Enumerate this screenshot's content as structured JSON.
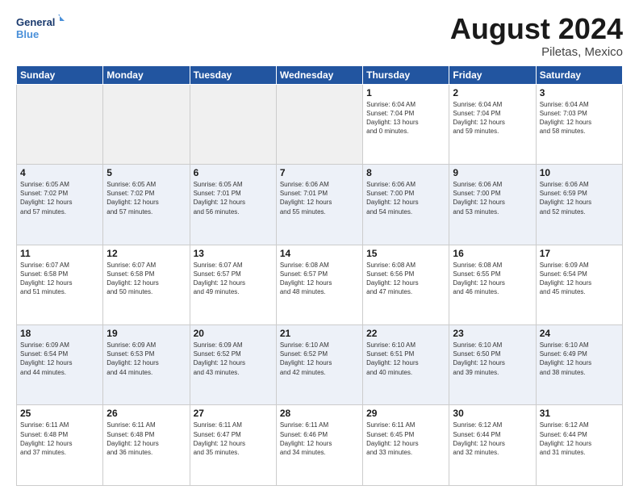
{
  "logo": {
    "line1": "General",
    "line2": "Blue"
  },
  "title": "August 2024",
  "location": "Piletas, Mexico",
  "days_of_week": [
    "Sunday",
    "Monday",
    "Tuesday",
    "Wednesday",
    "Thursday",
    "Friday",
    "Saturday"
  ],
  "weeks": [
    [
      {
        "day": "",
        "info": ""
      },
      {
        "day": "",
        "info": ""
      },
      {
        "day": "",
        "info": ""
      },
      {
        "day": "",
        "info": ""
      },
      {
        "day": "1",
        "info": "Sunrise: 6:04 AM\nSunset: 7:04 PM\nDaylight: 13 hours\nand 0 minutes."
      },
      {
        "day": "2",
        "info": "Sunrise: 6:04 AM\nSunset: 7:04 PM\nDaylight: 12 hours\nand 59 minutes."
      },
      {
        "day": "3",
        "info": "Sunrise: 6:04 AM\nSunset: 7:03 PM\nDaylight: 12 hours\nand 58 minutes."
      }
    ],
    [
      {
        "day": "4",
        "info": "Sunrise: 6:05 AM\nSunset: 7:02 PM\nDaylight: 12 hours\nand 57 minutes."
      },
      {
        "day": "5",
        "info": "Sunrise: 6:05 AM\nSunset: 7:02 PM\nDaylight: 12 hours\nand 57 minutes."
      },
      {
        "day": "6",
        "info": "Sunrise: 6:05 AM\nSunset: 7:01 PM\nDaylight: 12 hours\nand 56 minutes."
      },
      {
        "day": "7",
        "info": "Sunrise: 6:06 AM\nSunset: 7:01 PM\nDaylight: 12 hours\nand 55 minutes."
      },
      {
        "day": "8",
        "info": "Sunrise: 6:06 AM\nSunset: 7:00 PM\nDaylight: 12 hours\nand 54 minutes."
      },
      {
        "day": "9",
        "info": "Sunrise: 6:06 AM\nSunset: 7:00 PM\nDaylight: 12 hours\nand 53 minutes."
      },
      {
        "day": "10",
        "info": "Sunrise: 6:06 AM\nSunset: 6:59 PM\nDaylight: 12 hours\nand 52 minutes."
      }
    ],
    [
      {
        "day": "11",
        "info": "Sunrise: 6:07 AM\nSunset: 6:58 PM\nDaylight: 12 hours\nand 51 minutes."
      },
      {
        "day": "12",
        "info": "Sunrise: 6:07 AM\nSunset: 6:58 PM\nDaylight: 12 hours\nand 50 minutes."
      },
      {
        "day": "13",
        "info": "Sunrise: 6:07 AM\nSunset: 6:57 PM\nDaylight: 12 hours\nand 49 minutes."
      },
      {
        "day": "14",
        "info": "Sunrise: 6:08 AM\nSunset: 6:57 PM\nDaylight: 12 hours\nand 48 minutes."
      },
      {
        "day": "15",
        "info": "Sunrise: 6:08 AM\nSunset: 6:56 PM\nDaylight: 12 hours\nand 47 minutes."
      },
      {
        "day": "16",
        "info": "Sunrise: 6:08 AM\nSunset: 6:55 PM\nDaylight: 12 hours\nand 46 minutes."
      },
      {
        "day": "17",
        "info": "Sunrise: 6:09 AM\nSunset: 6:54 PM\nDaylight: 12 hours\nand 45 minutes."
      }
    ],
    [
      {
        "day": "18",
        "info": "Sunrise: 6:09 AM\nSunset: 6:54 PM\nDaylight: 12 hours\nand 44 minutes."
      },
      {
        "day": "19",
        "info": "Sunrise: 6:09 AM\nSunset: 6:53 PM\nDaylight: 12 hours\nand 44 minutes."
      },
      {
        "day": "20",
        "info": "Sunrise: 6:09 AM\nSunset: 6:52 PM\nDaylight: 12 hours\nand 43 minutes."
      },
      {
        "day": "21",
        "info": "Sunrise: 6:10 AM\nSunset: 6:52 PM\nDaylight: 12 hours\nand 42 minutes."
      },
      {
        "day": "22",
        "info": "Sunrise: 6:10 AM\nSunset: 6:51 PM\nDaylight: 12 hours\nand 40 minutes."
      },
      {
        "day": "23",
        "info": "Sunrise: 6:10 AM\nSunset: 6:50 PM\nDaylight: 12 hours\nand 39 minutes."
      },
      {
        "day": "24",
        "info": "Sunrise: 6:10 AM\nSunset: 6:49 PM\nDaylight: 12 hours\nand 38 minutes."
      }
    ],
    [
      {
        "day": "25",
        "info": "Sunrise: 6:11 AM\nSunset: 6:48 PM\nDaylight: 12 hours\nand 37 minutes."
      },
      {
        "day": "26",
        "info": "Sunrise: 6:11 AM\nSunset: 6:48 PM\nDaylight: 12 hours\nand 36 minutes."
      },
      {
        "day": "27",
        "info": "Sunrise: 6:11 AM\nSunset: 6:47 PM\nDaylight: 12 hours\nand 35 minutes."
      },
      {
        "day": "28",
        "info": "Sunrise: 6:11 AM\nSunset: 6:46 PM\nDaylight: 12 hours\nand 34 minutes."
      },
      {
        "day": "29",
        "info": "Sunrise: 6:11 AM\nSunset: 6:45 PM\nDaylight: 12 hours\nand 33 minutes."
      },
      {
        "day": "30",
        "info": "Sunrise: 6:12 AM\nSunset: 6:44 PM\nDaylight: 12 hours\nand 32 minutes."
      },
      {
        "day": "31",
        "info": "Sunrise: 6:12 AM\nSunset: 6:44 PM\nDaylight: 12 hours\nand 31 minutes."
      }
    ]
  ]
}
